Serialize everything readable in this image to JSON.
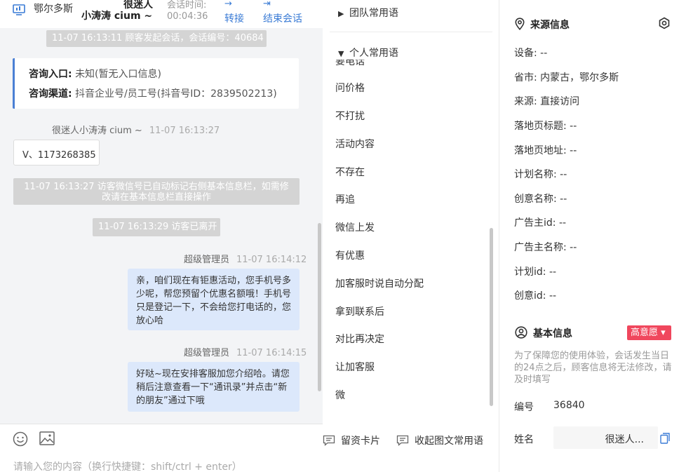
{
  "header": {
    "location": "鄂尔多斯",
    "name_top": "很迷人",
    "name": "小涛涛 cium ~",
    "time_label": "会话时间:",
    "time_value": "00:04:36",
    "transfer_label": "转接",
    "end_label": "结束会话"
  },
  "chat": {
    "system_start": "11-07 16:13:11 顾客发起会话，会话编号：40684",
    "entry_label": "咨询入口:",
    "entry_value": "未知(暂无入口信息)",
    "channel_label": "咨询渠道:",
    "channel_value": "抖音企业号/员工号(抖音号ID：2839502213)",
    "customer_sender": "很迷人小涛涛 cium ~",
    "customer_time": "11-07 16:13:27",
    "customer_msg": "V、1173268385",
    "system_wechat": "11-07 16:13:27 访客微信号已自动标记右侧基本信息栏，如需修改请在基本信息栏直接操作",
    "system_left": "11-07 16:13:29 访客已离开",
    "admin_sender": "超级管理员",
    "admin_time_1": "11-07 16:14:12",
    "admin_msg_1": "亲，咱们现在有钜惠活动，您手机号多少呢，帮您预留个优惠名额哦！手机号只是登记一下，不会给您打电话的，您放心哈",
    "admin_time_2": "11-07 16:14:15",
    "admin_msg_2": "好哒~现在安排客服加您介绍哈。请您稍后注意查看一下“通讯录”并点击“新的朋友”通过下哦",
    "input_placeholder": "请输入您的内容（换行快捷键：shift/ctrl + enter）"
  },
  "phrases": {
    "team_group": "团队常用语",
    "personal_group": "个人常用语",
    "partial_item": "要电话",
    "items": [
      "问价格",
      "不打扰",
      "活动内容",
      "不存在",
      "再追",
      "微信上发",
      "有优惠",
      "加客服时说自动分配",
      "拿到联系后",
      "对比再决定",
      "让加客服",
      "微"
    ],
    "card_button": "留资卡片",
    "fold_button": "收起图文常用语"
  },
  "info": {
    "source_title": "来源信息",
    "fields": [
      "设备: --",
      "省市: 内蒙古，鄂尔多斯",
      "来源: 直接访问",
      "落地页标题: --",
      "落地页地址: --",
      "计划名称: --",
      "创意名称: --",
      "广告主id: --",
      "广告主名称: --",
      "计划id: --",
      "创意id: --"
    ],
    "basic_title": "基本信息",
    "intent_badge": "高意愿 ▾",
    "notice": "为了保障您的使用体验，会话发生当日的24点之后，顾客信息将无法修改，请及时填写",
    "number_label": "编号",
    "number_value": "36840",
    "name_label": "姓名",
    "name_value": "很迷人..."
  },
  "colors": {
    "accent": "#3a7bd5",
    "bubble_out": "#dce8fb",
    "badge": "#f0475d",
    "system_msg": "#d4d4d4"
  }
}
